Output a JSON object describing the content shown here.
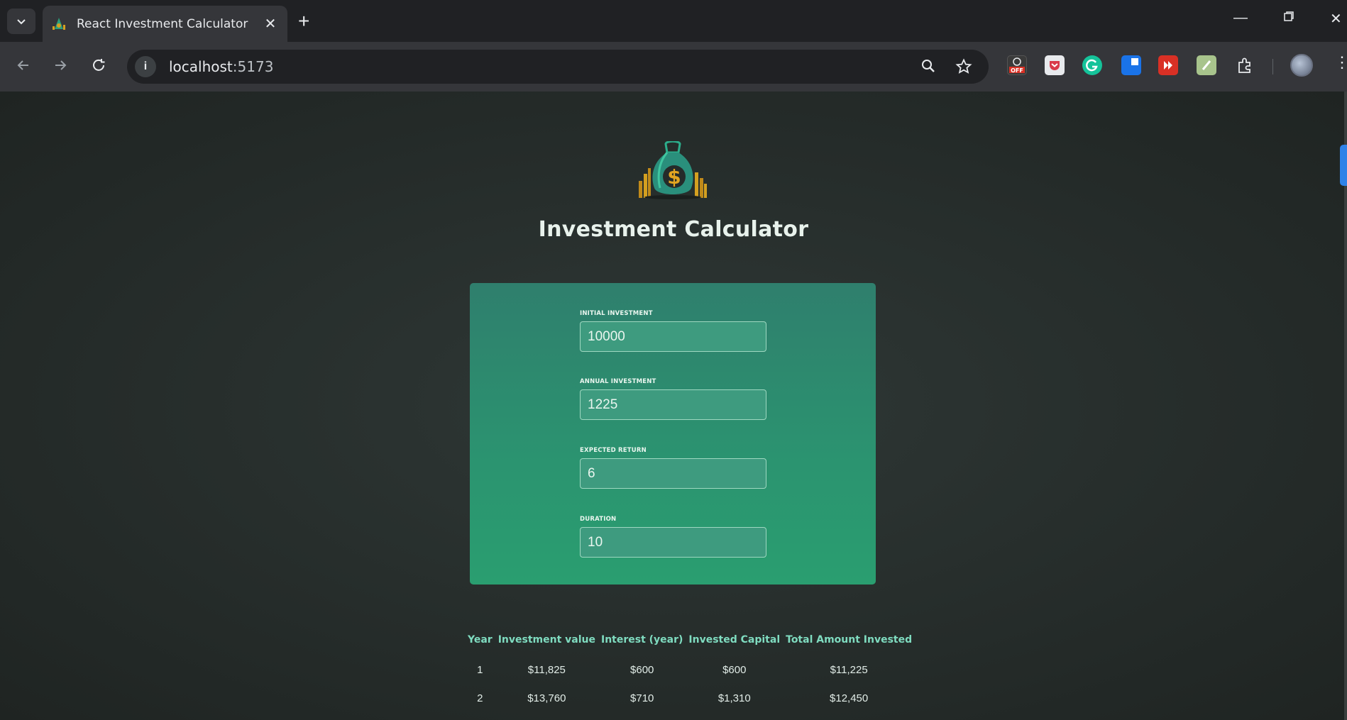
{
  "browser": {
    "tab_title": "React Investment Calculator",
    "url_host": "localhost",
    "url_port": ":5173",
    "extensions": [
      {
        "name": "off-extension-icon",
        "color": "#3a3a3a"
      },
      {
        "name": "pocket-icon",
        "color": "#e8eaed"
      },
      {
        "name": "grammarly-icon",
        "color": "#15c39a"
      },
      {
        "name": "blue-extension-icon",
        "color": "#1a73e8"
      },
      {
        "name": "red-extension-icon",
        "color": "#d93025"
      },
      {
        "name": "notes-extension-icon",
        "color": "#a8c48c"
      }
    ]
  },
  "app": {
    "title": "Investment Calculator"
  },
  "inputs": [
    {
      "label": "Initial Investment",
      "value": "10000"
    },
    {
      "label": "Annual Investment",
      "value": "1225"
    },
    {
      "label": "Expected Return",
      "value": "6"
    },
    {
      "label": "Duration",
      "value": "10"
    }
  ],
  "results": {
    "headers": [
      "Year",
      "Investment value",
      "Interest (year)",
      "Invested Capital",
      "Total Amount Invested"
    ],
    "rows": [
      [
        "1",
        "$11,825",
        "$600",
        "$600",
        "$11,225"
      ],
      [
        "2",
        "$13,760",
        "$710",
        "$1,310",
        "$12,450"
      ]
    ]
  },
  "colors": {
    "card_top": "#2f7f6d",
    "card_bottom": "#2a9e70",
    "header_text": "#7fdcc0"
  }
}
